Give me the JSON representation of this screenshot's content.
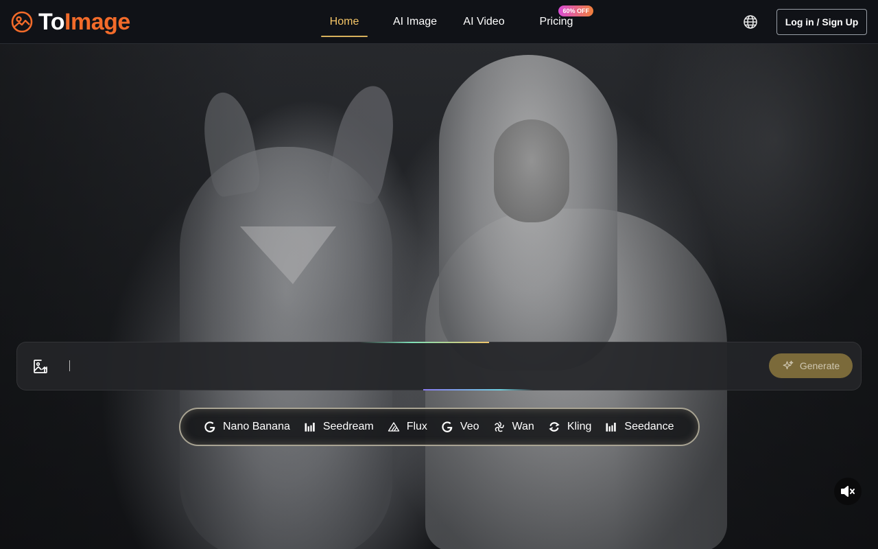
{
  "brand": {
    "name_part1": "To",
    "name_part2": "Image",
    "accent_color": "#f26b2a"
  },
  "nav": {
    "items": [
      {
        "label": "Home",
        "active": true
      },
      {
        "label": "AI Image",
        "active": false
      },
      {
        "label": "AI Video",
        "active": false
      },
      {
        "label": "Pricing",
        "active": false,
        "badge": "60% OFF"
      }
    ],
    "active_color": "#f6c667"
  },
  "header": {
    "language_icon": "globe-icon",
    "login_label": "Log in / Sign Up"
  },
  "hero": {
    "background": "photo of a white-haired woman in silver armor beside a white horse"
  },
  "prompt": {
    "value": "",
    "placeholder": "",
    "upload_icon": "image-upload-icon",
    "generate_label": "Generate",
    "generate_color": "#7b6a3a"
  },
  "models": [
    {
      "label": "Nano Banana",
      "icon": "google-icon"
    },
    {
      "label": "Seedream",
      "icon": "bars-icon"
    },
    {
      "label": "Flux",
      "icon": "flux-triangle-icon"
    },
    {
      "label": "Veo",
      "icon": "google-icon"
    },
    {
      "label": "Wan",
      "icon": "wan-swirl-icon"
    },
    {
      "label": "Kling",
      "icon": "kling-loop-icon"
    },
    {
      "label": "Seedance",
      "icon": "bars-icon"
    }
  ],
  "media": {
    "mute_icon": "speaker-muted-icon"
  }
}
